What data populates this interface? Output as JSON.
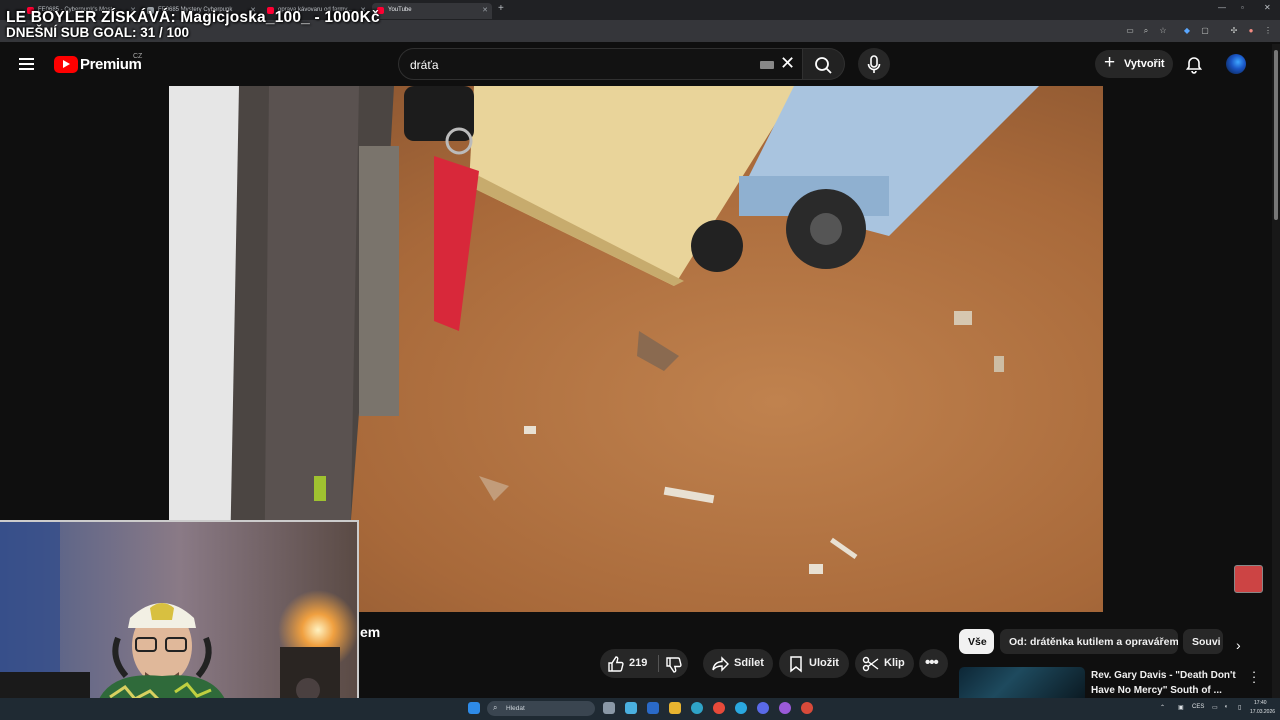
{
  "overlay": {
    "line1": "LE BOYLER ZÍSKÁVÁ: Magicjoska_100_ - 1000Kč",
    "line2": "DNEŠNÍ SUB GOAL: 31 / 100"
  },
  "browser": {
    "tabs": [
      {
        "label": "FE0685 - Cyberpunk's Most..."
      },
      {
        "label": "FE0685 Mystery Cyberpunk"
      },
      {
        "label": "oprava kávovaru od farmy..."
      },
      {
        "label": "YouTube"
      }
    ],
    "new_tab": "+",
    "window_controls": [
      "—",
      "▫",
      "✕"
    ]
  },
  "header": {
    "brand": "Premium",
    "country": "CZ",
    "search_value": "dráťa",
    "create_label": "Vytvořit"
  },
  "video": {
    "title_fragment": "em"
  },
  "actions": {
    "likes": "219",
    "share": "Sdílet",
    "save": "Uložit",
    "clip": "Klip"
  },
  "chips": [
    {
      "label": "Vše",
      "selected": true
    },
    {
      "label": "Od: drátěnka kutilem a opravářem",
      "selected": false
    },
    {
      "label": "Souvi",
      "selected": false
    }
  ],
  "recommendation": {
    "title": "Rev. Gary Davis - \"Death Don't Have No Mercy\" South of ..."
  },
  "taskbar": {
    "search_placeholder": "Hledat",
    "lang": "CES",
    "time": "17:40",
    "date": "17.03.2026"
  },
  "colors": {
    "background": "#0f0f0f",
    "yt_red": "#ff0000",
    "pill": "#272727"
  }
}
